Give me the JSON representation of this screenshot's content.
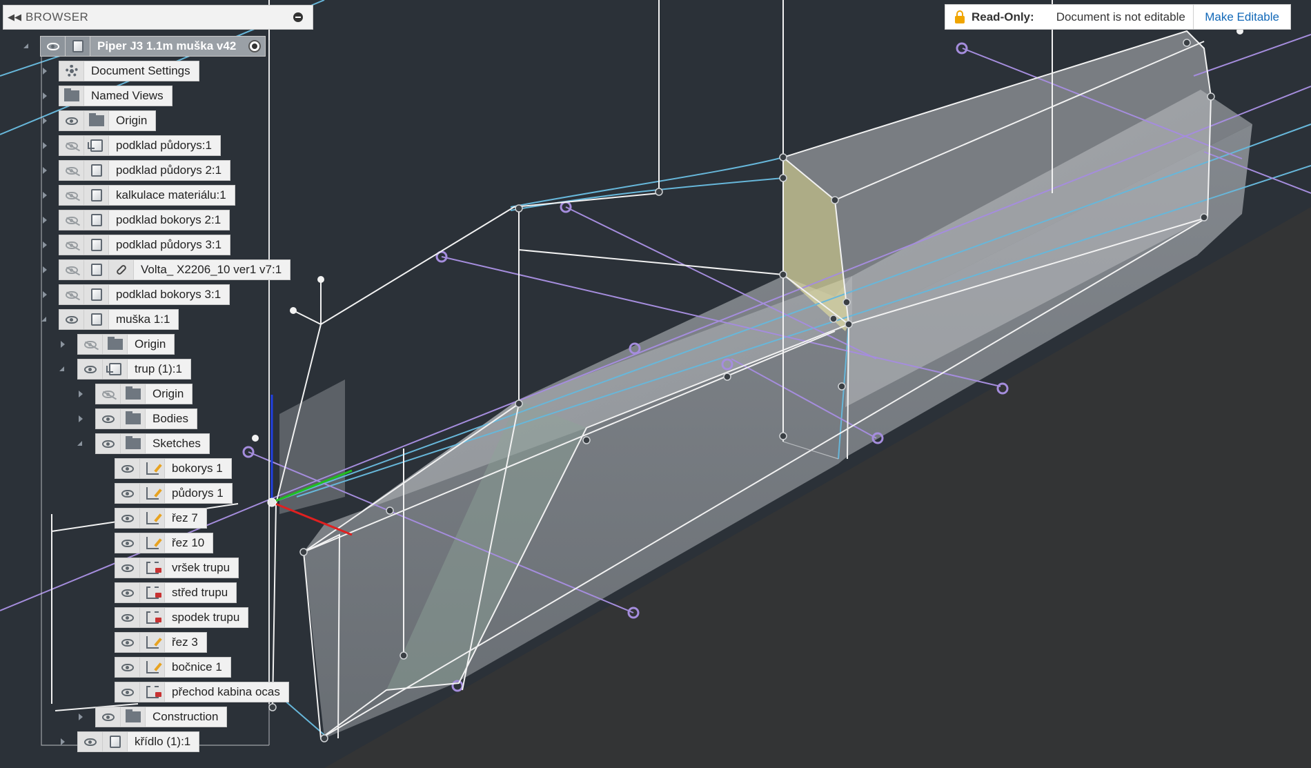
{
  "browser": {
    "title": "BROWSER"
  },
  "readonly": {
    "label": "Read-Only:",
    "message": "Document is not editable",
    "action": "Make Editable"
  },
  "tree": {
    "root": "Piper J3 1.1m muška v42",
    "document_settings": "Document Settings",
    "named_views": "Named Views",
    "origin": "Origin",
    "items": [
      "podklad půdorys:1",
      "podklad půdorys 2:1",
      "kalkulace materiálu:1",
      "podklad bokorys 2:1",
      "podklad půdorys 3:1",
      "Volta_ X2206_10 ver1 v7:1",
      "podklad bokorys 3:1",
      "muška 1:1"
    ],
    "muska": {
      "origin": "Origin",
      "trup": "trup (1):1",
      "trup_children": {
        "origin": "Origin",
        "bodies": "Bodies",
        "sketches": "Sketches",
        "sketch_items": [
          "bokorys 1",
          "půdorys 1",
          "řez 7",
          "řez 10",
          "vršek trupu",
          "střed trupu",
          "spodek trupu",
          "řez 3",
          "bočnice 1",
          "přechod kabina ocas"
        ],
        "construction": "Construction"
      },
      "kridlo": "křídlo (1):1"
    }
  },
  "colors": {
    "canvas_bg": "#2b3138",
    "sketch_line": "#ffffff",
    "profile_blue": "#67b7da",
    "construction_purple": "#a58ddd",
    "fuselage_fill": "#c6c9cc",
    "cabin_fill": "#d9d6a0",
    "axis_x": "#e02020",
    "axis_y": "#20c020",
    "axis_z": "#2040e0"
  }
}
